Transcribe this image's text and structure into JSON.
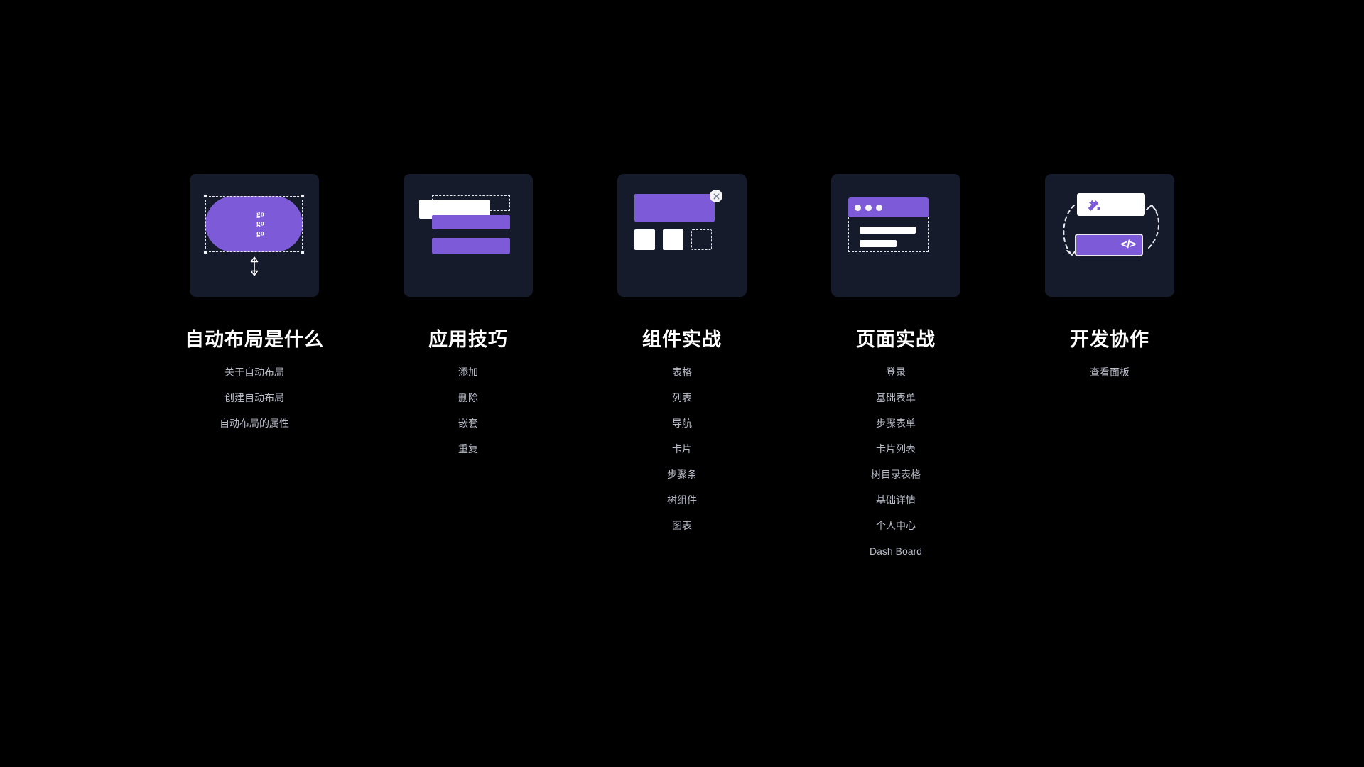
{
  "page": {
    "background_color": "#000000",
    "card_background_color": "#161b2b",
    "accent_purple": "#7c5ad8",
    "title_color": "#ffffff",
    "link_color": "#b9bdc9"
  },
  "columns": [
    {
      "id": "auto-layout-basics",
      "title": "自动布局是什么",
      "thumbnail": {
        "kind": "selection-frame",
        "shape_label": "go\ngo\ngo",
        "icons": [
          "selection-handle-icon",
          "resize-vertical-arrow-icon"
        ]
      },
      "links": [
        "关于自动布局",
        "创建自动布局",
        "自动布局的属性"
      ]
    },
    {
      "id": "application-tips",
      "title": "应用技巧",
      "thumbnail": {
        "kind": "stacked-bars",
        "icons": [
          "dashed-frame-icon",
          "bar-icon"
        ]
      },
      "links": [
        "添加",
        "删除",
        "嵌套",
        "重复"
      ]
    },
    {
      "id": "component-practice",
      "title": "组件实战",
      "thumbnail": {
        "kind": "component-panel",
        "icons": [
          "close-icon",
          "square-icon",
          "dashed-square-icon"
        ]
      },
      "links": [
        "表格",
        "列表",
        "导航",
        "卡片",
        "步骤条",
        "树组件",
        "图表"
      ]
    },
    {
      "id": "page-practice",
      "title": "页面实战",
      "thumbnail": {
        "kind": "browser-window",
        "icons": [
          "window-dot-icon",
          "dashed-frame-icon"
        ]
      },
      "links": [
        "登录",
        "基础表单",
        "步骤表单",
        "卡片列表",
        "树目录表格",
        "基础详情",
        "个人中心",
        "Dash Board"
      ]
    },
    {
      "id": "dev-collaboration",
      "title": "开发协作",
      "thumbnail": {
        "kind": "design-dev-handoff",
        "code_label": "</>",
        "icons": [
          "magic-wand-icon",
          "code-icon",
          "circular-arrow-icon"
        ]
      },
      "links": [
        "查看面板"
      ]
    }
  ]
}
